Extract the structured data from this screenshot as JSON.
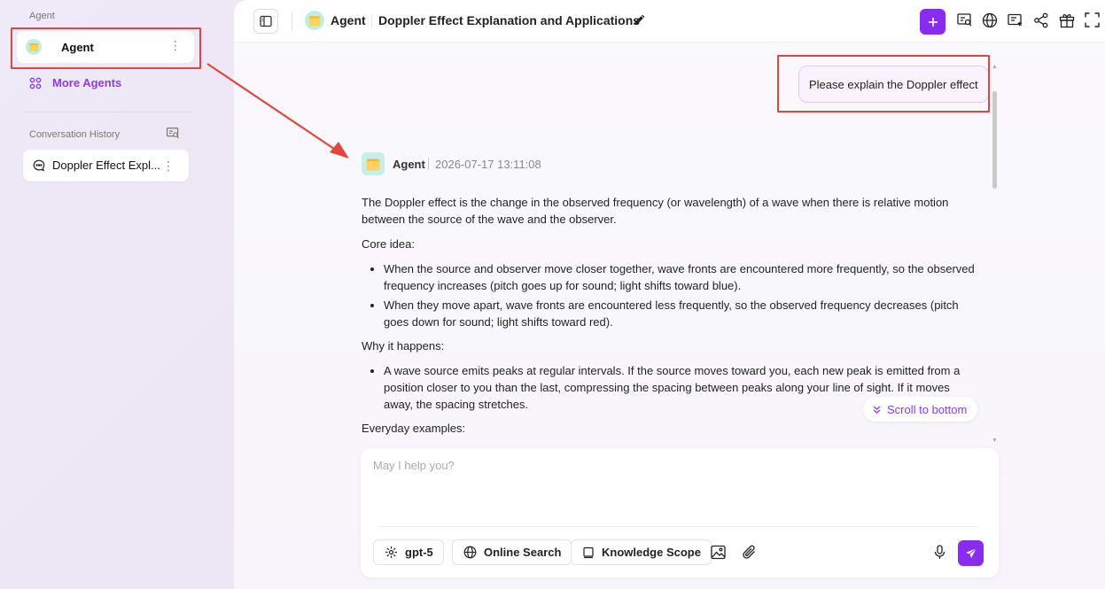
{
  "sidebar": {
    "agent_section_label": "Agent",
    "agent_item_label": "Agent",
    "more_agents_label": "More Agents",
    "history_label": "Conversation History",
    "conversations": [
      {
        "label": "Doppler Effect Expl..."
      }
    ]
  },
  "topbar": {
    "agent_name": "Agent",
    "conversation_title": "Doppler Effect Explanation and Applications"
  },
  "chat": {
    "user_message": "Please explain the Doppler effect",
    "agent_name": "Agent",
    "timestamp": "2026-07-17 13:11:08",
    "intro": "The Doppler effect is the change in the observed frequency (or wavelength) of a wave when there is relative motion between the source of the wave and the observer.",
    "core_idea_heading": "Core idea:",
    "core_idea_items": [
      "When the source and observer move closer together, wave fronts are encountered more frequently, so the observed frequency increases (pitch goes up for sound; light shifts toward blue).",
      "When they move apart, wave fronts are encountered less frequently, so the observed frequency decreases (pitch goes down for sound; light shifts toward red)."
    ],
    "why_heading": "Why it happens:",
    "why_items": [
      "A wave source emits peaks at regular intervals. If the source moves toward you, each new peak is emitted from a position closer to you than the last, compressing the spacing between peaks along your line of sight. If it moves away, the spacing stretches."
    ],
    "examples_heading": "Everyday examples:",
    "scroll_to_bottom_label": "Scroll to bottom"
  },
  "composer": {
    "placeholder": "May I help you?",
    "model_label": "gpt-5",
    "online_search_label": "Online Search",
    "knowledge_scope_label": "Knowledge Scope"
  },
  "colors": {
    "accent": "#8a2bf2",
    "annotation": "#e0463e"
  }
}
